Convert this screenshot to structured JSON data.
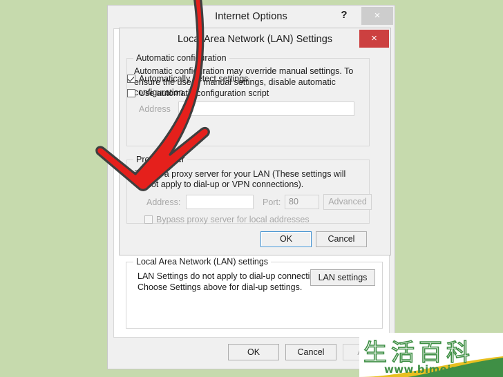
{
  "background": {
    "color": "#c6daad"
  },
  "internet_options": {
    "title": "Internet Options",
    "help_icon": "?",
    "close_icon": "×",
    "lan_group": {
      "legend": "Local Area Network (LAN) settings",
      "description_line1": "LAN Settings do not apply to dial-up connections.",
      "description_line2": "Choose Settings above for dial-up settings.",
      "lan_settings_button": "LAN settings"
    },
    "buttons": {
      "ok": "OK",
      "cancel": "Cancel",
      "apply": "Apply"
    }
  },
  "lan_settings": {
    "title": "Local Area Network (LAN) Settings",
    "close_icon": "×",
    "automatic_configuration": {
      "legend": "Automatic configuration",
      "description": "Automatic configuration may override manual settings.  To ensure the use of manual settings, disable automatic configuration.",
      "auto_detect_checkbox": {
        "label": "Automatically detect settings",
        "checked": true
      },
      "use_script_checkbox": {
        "label": "Use automatic configuration script",
        "checked": false
      },
      "address_label": "Address",
      "address_value": ""
    },
    "proxy_server": {
      "legend": "Proxy server",
      "use_proxy_checkbox": {
        "label": "Use a proxy server for your LAN (These settings will not apply to dial-up or VPN connections).",
        "checked": false
      },
      "address_label": "Address:",
      "address_value": "",
      "port_label": "Port:",
      "port_value": "80",
      "advanced_button": "Advanced",
      "bypass_checkbox": {
        "label": "Bypass proxy server for local addresses",
        "checked": false
      }
    },
    "buttons": {
      "ok": "OK",
      "cancel": "Cancel"
    }
  },
  "annotation": {
    "arrow_color": "#e02020",
    "arrow_outline_color": "#4a4a4a",
    "points_to": "use-proxy-server-checkbox"
  },
  "watermark": {
    "characters": "生活百科",
    "url": "www.bimeiz.com",
    "green": "#3f8f45",
    "yellow": "#e8c020"
  }
}
